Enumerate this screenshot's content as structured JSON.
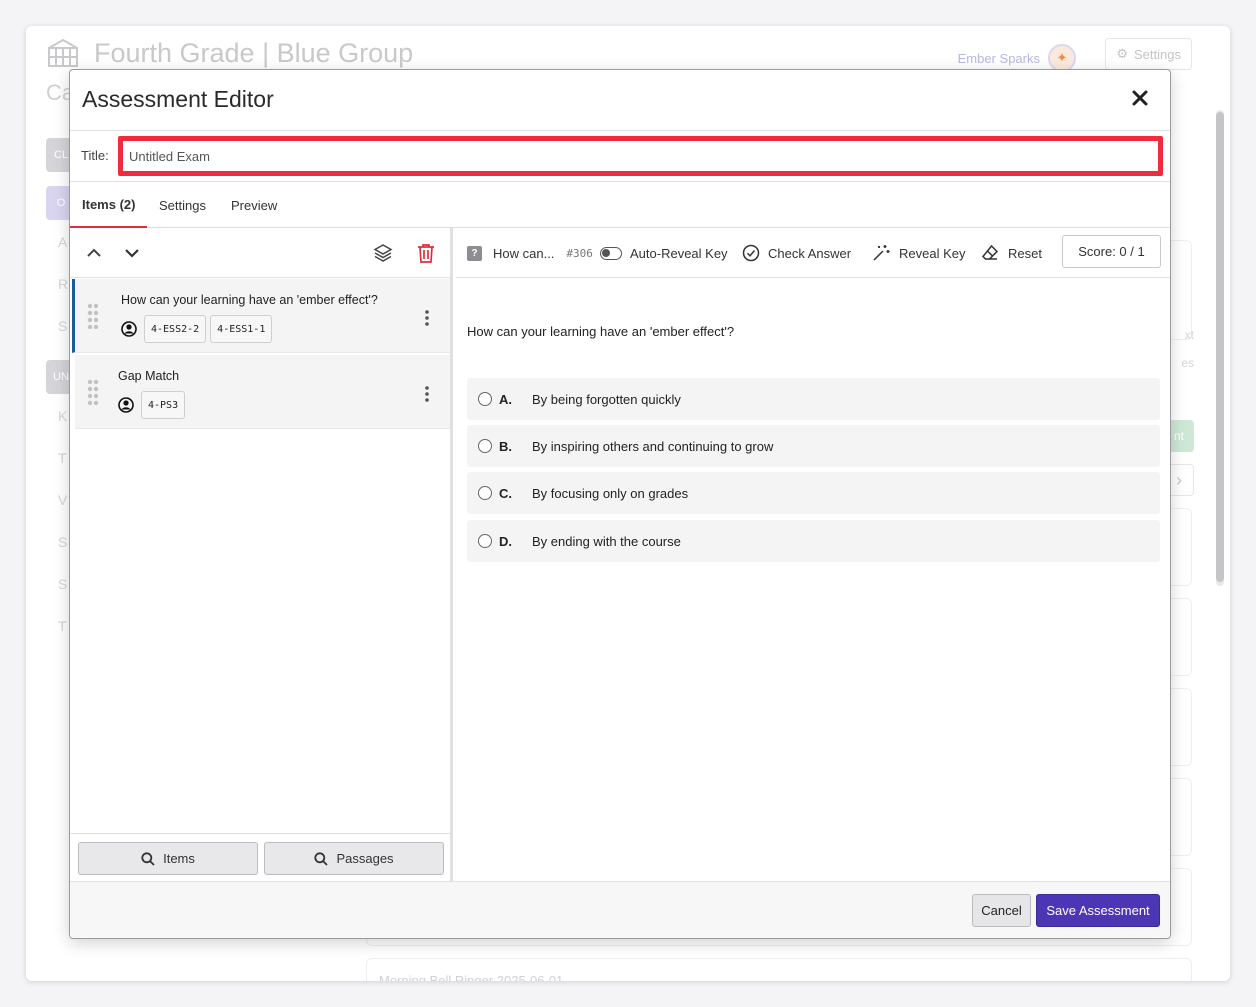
{
  "background": {
    "class_title": "Fourth Grade | Blue Group",
    "class_subtitle": "Ca",
    "user_name": "Ember Sparks",
    "settings_label": "Settings",
    "sidebar_pills": [
      {
        "text": "CL",
        "color": "#d5d5d9"
      },
      {
        "text": "O",
        "color": "#d9d4f0"
      },
      {
        "text": "UN",
        "color": "#d5d5d9"
      }
    ],
    "sidebar_letters_top": [
      "A",
      "R",
      "S"
    ],
    "sidebar_letters_bottom": [
      "K",
      "T",
      "V",
      "S",
      "S",
      "T"
    ],
    "right_fragments": [
      "xt",
      "es",
      "nt"
    ],
    "bottom_text": "Morning Bell Ringer 2025-06-01"
  },
  "modal": {
    "title": "Assessment Editor",
    "title_label": "Title:",
    "title_value": "Untitled Exam",
    "tabs": [
      "Items (2)",
      "Settings",
      "Preview"
    ],
    "items": [
      {
        "title": "How can your learning have an 'ember effect'?",
        "tags": [
          "4-ESS2-2",
          "4-ESS1-1"
        ]
      },
      {
        "title": "Gap Match",
        "tags": [
          "4-PS3"
        ]
      }
    ],
    "search_items_label": "Items",
    "search_passages_label": "Passages",
    "toolbar": {
      "question_badge": "?",
      "question_short": "How can...",
      "question_id": "#306",
      "auto_reveal_label": "Auto-Reveal Key",
      "check_answer_label": "Check Answer",
      "reveal_key_label": "Reveal Key",
      "reset_label": "Reset",
      "score": "Score: 0 / 1"
    },
    "question": {
      "prompt": "How can your learning have an 'ember effect'?",
      "choices": [
        {
          "letter": "A.",
          "text": "By being forgotten quickly"
        },
        {
          "letter": "B.",
          "text": "By inspiring others and continuing to grow"
        },
        {
          "letter": "C.",
          "text": "By focusing only on grades"
        },
        {
          "letter": "D.",
          "text": "By ending with the course"
        }
      ]
    },
    "cancel_label": "Cancel",
    "save_label": "Save Assessment",
    "colors": {
      "accent": "#4c36b5",
      "highlight": "#ef2b3c",
      "delete": "#d9303b",
      "active_item": "#1e5c96"
    }
  }
}
